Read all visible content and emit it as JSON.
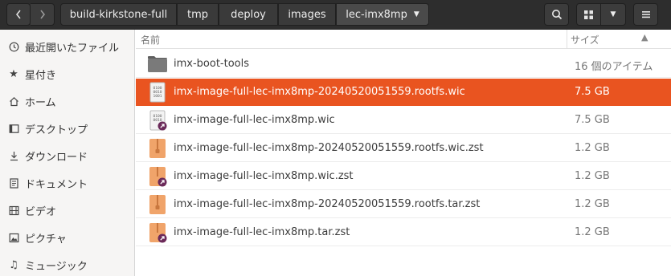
{
  "toolbar": {
    "back_icon": "chevron-left-icon",
    "forward_icon": "chevron-right-icon",
    "breadcrumbs": [
      "build-kirkstone-full",
      "tmp",
      "deploy",
      "images",
      "lec-imx8mp"
    ],
    "search_icon": "search-icon",
    "view_icon": "grid-view-icon",
    "view_menu_icon": "chevron-down-icon",
    "menu_icon": "hamburger-menu-icon"
  },
  "sidebar": {
    "items": [
      {
        "label": "最近開いたファイル",
        "icon": "clock-icon"
      },
      {
        "label": "星付き",
        "icon": "star-icon"
      },
      {
        "label": "ホーム",
        "icon": "home-icon"
      },
      {
        "label": "デスクトップ",
        "icon": "desktop-icon"
      },
      {
        "label": "ダウンロード",
        "icon": "download-icon"
      },
      {
        "label": "ドキュメント",
        "icon": "document-icon"
      },
      {
        "label": "ビデオ",
        "icon": "video-icon"
      },
      {
        "label": "ピクチャ",
        "icon": "picture-icon"
      },
      {
        "label": "ミュージック",
        "icon": "music-icon"
      }
    ]
  },
  "columns": {
    "name": "名前",
    "size": "サイズ"
  },
  "files": [
    {
      "name": "imx-boot-tools",
      "size": "16 個のアイテム",
      "type": "folder",
      "selected": false
    },
    {
      "name": "imx-image-full-lec-imx8mp-20240520051559.rootfs.wic",
      "size": "7.5 GB",
      "type": "binary",
      "selected": true
    },
    {
      "name": "imx-image-full-lec-imx8mp.wic",
      "size": "7.5 GB",
      "type": "binary-link",
      "selected": false
    },
    {
      "name": "imx-image-full-lec-imx8mp-20240520051559.rootfs.wic.zst",
      "size": "1.2 GB",
      "type": "archive",
      "selected": false
    },
    {
      "name": "imx-image-full-lec-imx8mp.wic.zst",
      "size": "1.2 GB",
      "type": "archive-link",
      "selected": false
    },
    {
      "name": "imx-image-full-lec-imx8mp-20240520051559.rootfs.tar.zst",
      "size": "1.2 GB",
      "type": "archive",
      "selected": false
    },
    {
      "name": "imx-image-full-lec-imx8mp.tar.zst",
      "size": "1.2 GB",
      "type": "archive-link",
      "selected": false
    }
  ],
  "colors": {
    "header_bg": "#2d2d2d",
    "selection": "#e95420",
    "folder": "#7a7a7a",
    "archive": "#f0a46a",
    "link_badge": "#6b2a5a"
  }
}
